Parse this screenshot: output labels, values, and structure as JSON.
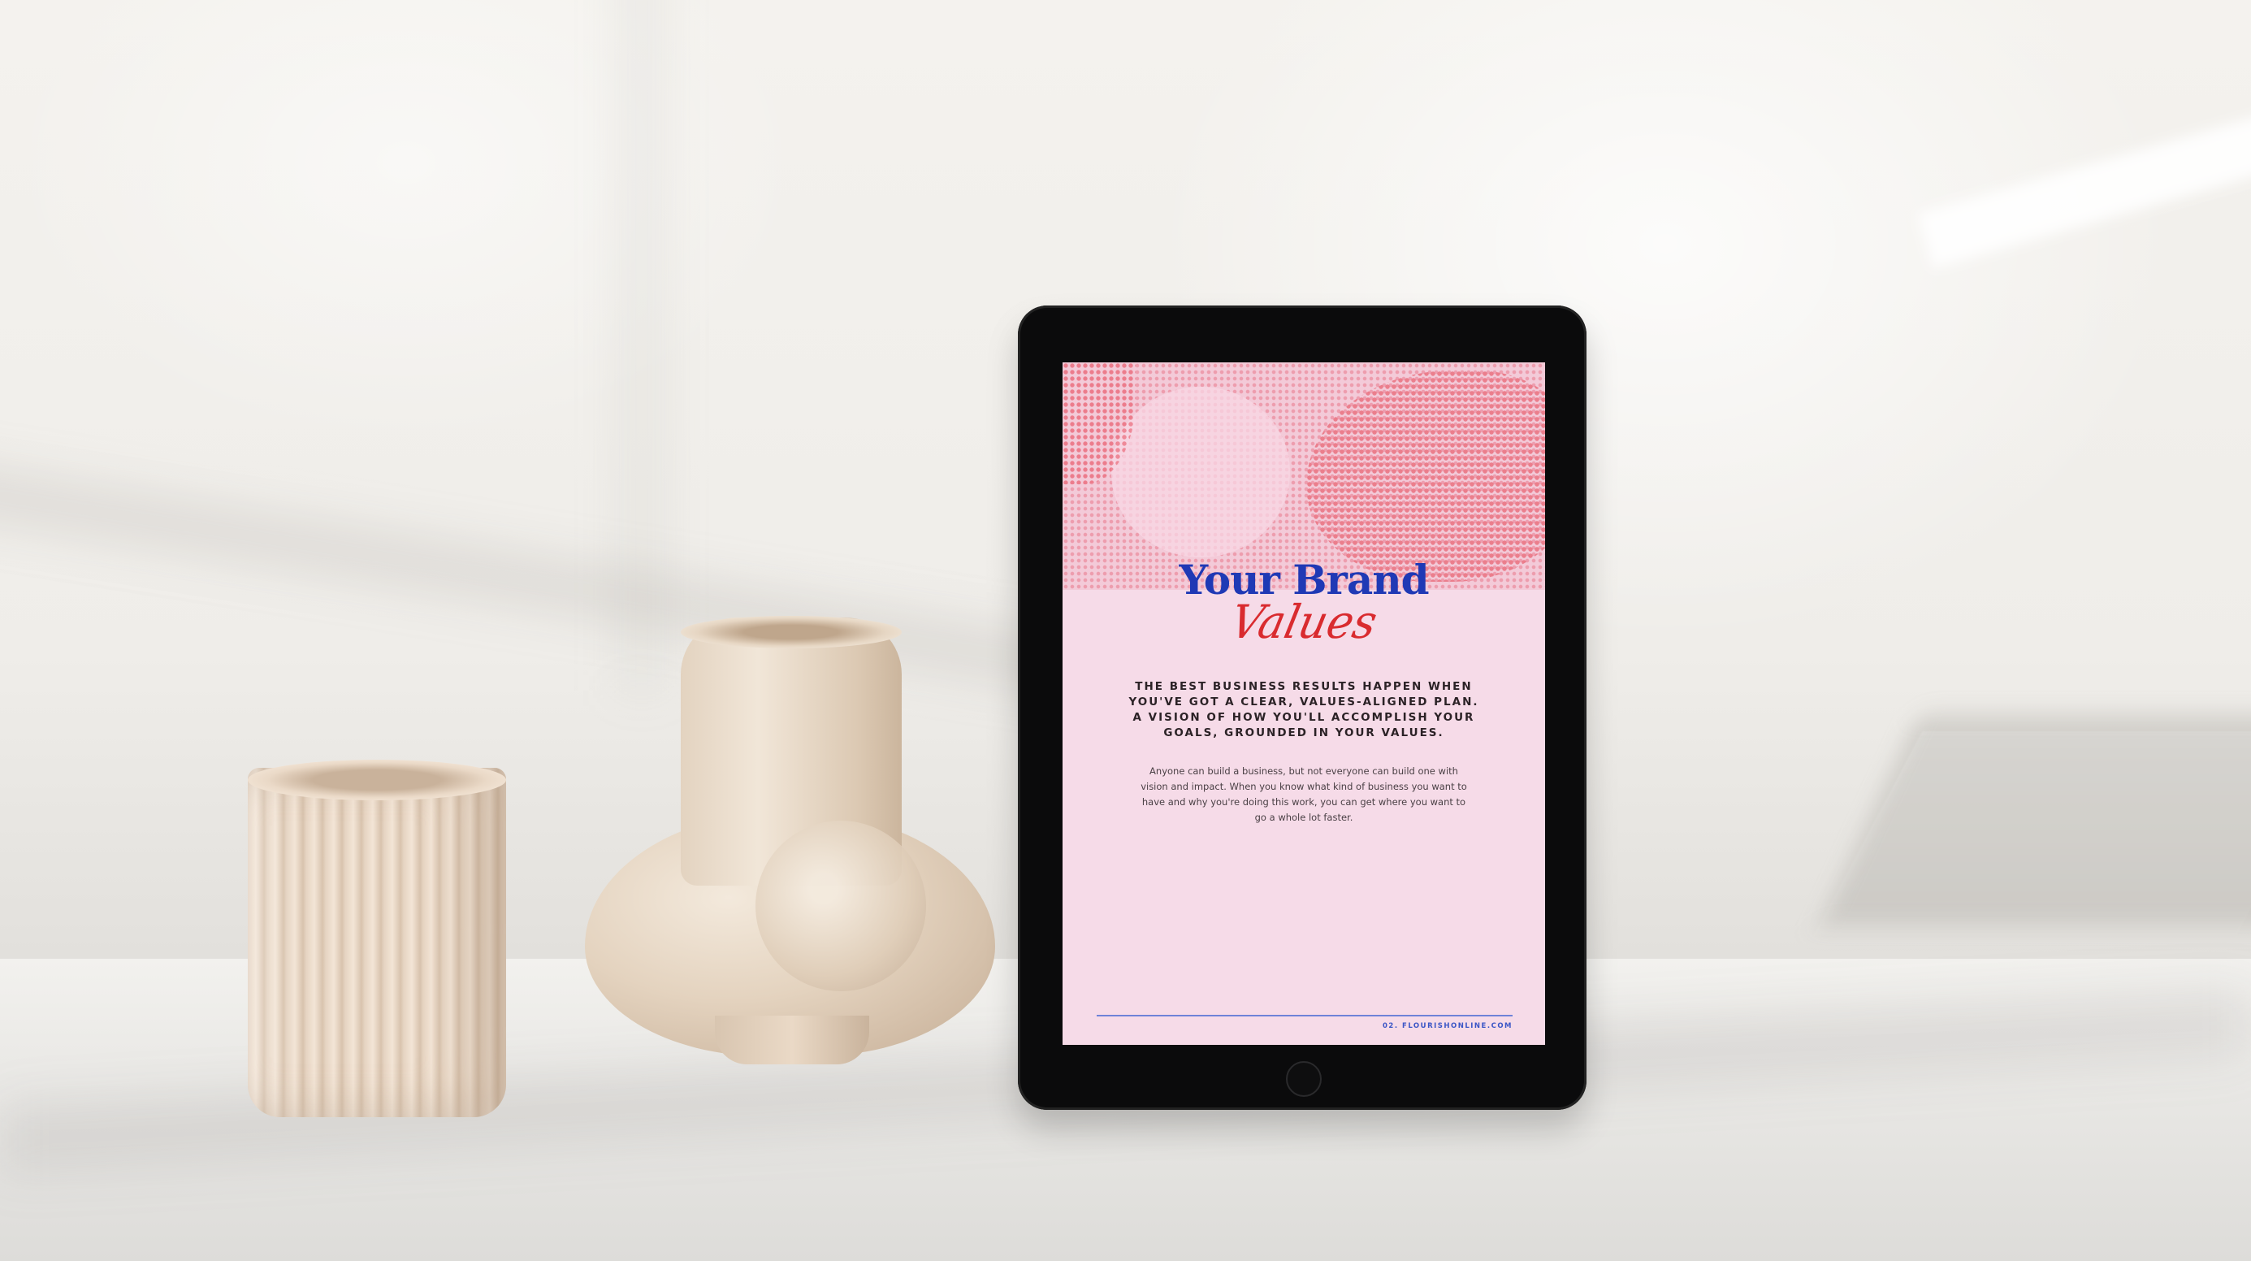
{
  "tablet_page": {
    "title": "Your Brand",
    "title_script": "Values",
    "heading": "THE BEST BUSINESS RESULTS HAPPEN WHEN\nYOU'VE GOT A CLEAR, VALUES-ALIGNED PLAN.\nA VISION OF HOW YOU'LL ACCOMPLISH YOUR\nGOALS, GROUNDED IN YOUR VALUES.",
    "body": "Anyone can build a business, but not everyone can build one with\nvision and impact. When you know what kind of business you want to\nhave and why you're doing this work, you can get where you want to\ngo a whole lot faster.",
    "footer": "02. FLOURISHONLINE.COM"
  },
  "colors": {
    "title_blue": "#1f39b5",
    "script_red": "#d92b2f",
    "screen_pink": "#f6dbe8",
    "halftone_coral": "#e8788c"
  },
  "icons": {
    "home_button": "home-button-icon"
  }
}
